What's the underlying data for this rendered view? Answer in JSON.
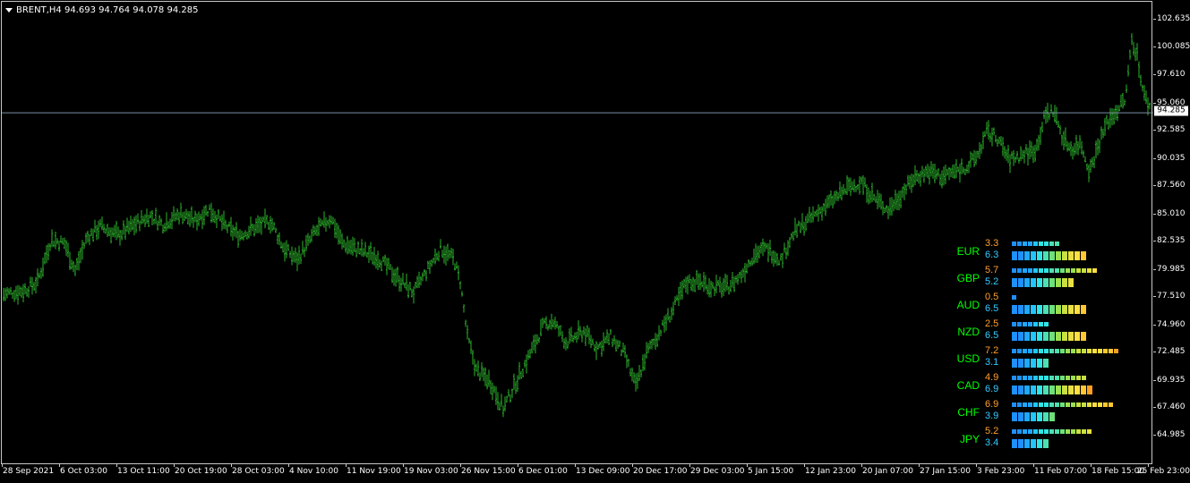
{
  "header": {
    "symbol_info": "BRENT,H4  94.693 94.764 94.078 94.285"
  },
  "price_axis": {
    "labels": [
      "102.635",
      "100.085",
      "97.610",
      "95.060",
      "92.585",
      "90.035",
      "87.560",
      "85.010",
      "82.535",
      "79.985",
      "77.510",
      "74.960",
      "72.485",
      "69.935",
      "67.460",
      "64.985"
    ],
    "label_values": [
      102.635,
      100.085,
      97.61,
      95.06,
      92.585,
      90.035,
      87.56,
      85.01,
      82.535,
      79.985,
      77.51,
      74.96,
      72.485,
      69.935,
      67.46,
      64.985
    ],
    "current_price": "94.285",
    "current_price_value": 94.285
  },
  "time_axis": {
    "labels": [
      "28 Sep 2021",
      "6 Oct 03:00",
      "13 Oct 11:00",
      "20 Oct 19:00",
      "28 Oct 03:00",
      "4 Nov 10:00",
      "11 Nov 19:00",
      "19 Nov 03:00",
      "26 Nov 15:00",
      "6 Dec 01:00",
      "13 Dec 09:00",
      "20 Dec 17:00",
      "29 Dec 03:00",
      "5 Jan 15:00",
      "12 Jan 23:00",
      "20 Jan 07:00",
      "27 Jan 15:00",
      "3 Feb 23:00",
      "11 Feb 07:00",
      "18 Feb 15:00",
      "25 Feb 23:00"
    ]
  },
  "chart_data": {
    "type": "line",
    "title": "",
    "xlabel": "",
    "ylabel": "",
    "ylim": [
      64.0,
      104.0
    ],
    "candle_color": "#2bb52b",
    "price_line_color": "#7a8fa6",
    "anchors": [
      [
        0,
        77.8
      ],
      [
        10,
        78.0
      ],
      [
        25,
        78.2
      ],
      [
        40,
        79.0
      ],
      [
        55,
        82.8
      ],
      [
        70,
        82.5
      ],
      [
        82,
        80.0
      ],
      [
        95,
        83.0
      ],
      [
        110,
        84.0
      ],
      [
        130,
        83.2
      ],
      [
        145,
        84.0
      ],
      [
        165,
        85.0
      ],
      [
        180,
        84.2
      ],
      [
        200,
        85.2
      ],
      [
        215,
        84.5
      ],
      [
        232,
        85.6
      ],
      [
        250,
        84.0
      ],
      [
        265,
        83.2
      ],
      [
        280,
        83.8
      ],
      [
        300,
        84.5
      ],
      [
        315,
        82.0
      ],
      [
        330,
        81.0
      ],
      [
        350,
        83.5
      ],
      [
        368,
        84.8
      ],
      [
        380,
        82.5
      ],
      [
        400,
        81.8
      ],
      [
        420,
        81.2
      ],
      [
        440,
        79.5
      ],
      [
        460,
        78.0
      ],
      [
        475,
        80.0
      ],
      [
        490,
        82.0
      ],
      [
        505,
        81.0
      ],
      [
        512,
        79.0
      ],
      [
        520,
        74.0
      ],
      [
        530,
        71.0
      ],
      [
        545,
        70.0
      ],
      [
        560,
        67.5
      ],
      [
        575,
        70.0
      ],
      [
        590,
        72.5
      ],
      [
        605,
        75.0
      ],
      [
        615,
        75.5
      ],
      [
        630,
        73.5
      ],
      [
        650,
        74.5
      ],
      [
        665,
        73.0
      ],
      [
        680,
        74.0
      ],
      [
        695,
        72.5
      ],
      [
        708,
        69.5
      ],
      [
        720,
        72.5
      ],
      [
        735,
        74.5
      ],
      [
        750,
        76.5
      ],
      [
        765,
        79.0
      ],
      [
        780,
        79.0
      ],
      [
        795,
        78.5
      ],
      [
        810,
        78.5
      ],
      [
        825,
        79.5
      ],
      [
        840,
        81.5
      ],
      [
        855,
        82.0
      ],
      [
        870,
        81.0
      ],
      [
        885,
        83.5
      ],
      [
        900,
        84.5
      ],
      [
        915,
        85.5
      ],
      [
        930,
        86.5
      ],
      [
        945,
        87.5
      ],
      [
        960,
        88.0
      ],
      [
        975,
        86.5
      ],
      [
        990,
        85.5
      ],
      [
        1005,
        87.0
      ],
      [
        1020,
        88.5
      ],
      [
        1035,
        89.0
      ],
      [
        1050,
        88.5
      ],
      [
        1065,
        89.0
      ],
      [
        1080,
        89.5
      ],
      [
        1090,
        90.5
      ],
      [
        1100,
        92.5
      ],
      [
        1112,
        92.0
      ],
      [
        1125,
        90.0
      ],
      [
        1140,
        90.5
      ],
      [
        1155,
        91.0
      ],
      [
        1165,
        94.0
      ],
      [
        1175,
        94.5
      ],
      [
        1185,
        92.0
      ],
      [
        1195,
        91.0
      ],
      [
        1205,
        91.5
      ],
      [
        1215,
        89.0
      ],
      [
        1225,
        91.5
      ],
      [
        1235,
        93.5
      ],
      [
        1245,
        94.5
      ],
      [
        1255,
        95.5
      ],
      [
        1262,
        101.0
      ],
      [
        1268,
        99.5
      ],
      [
        1275,
        96.0
      ],
      [
        1285,
        94.3
      ]
    ],
    "current_price": 94.285
  },
  "currency_strength": {
    "title": "",
    "rows": [
      {
        "name": "EUR",
        "v1": "3.3",
        "v2": "6.3",
        "n1": 3.3,
        "n2": 6.3
      },
      {
        "name": "GBP",
        "v1": "5.7",
        "v2": "5.2",
        "n1": 5.7,
        "n2": 5.2
      },
      {
        "name": "AUD",
        "v1": "0.5",
        "v2": "6.5",
        "n1": 0.5,
        "n2": 6.5
      },
      {
        "name": "NZD",
        "v1": "2.5",
        "v2": "6.5",
        "n1": 2.5,
        "n2": 6.5
      },
      {
        "name": "USD",
        "v1": "7.2",
        "v2": "3.1",
        "n1": 7.2,
        "n2": 3.1
      },
      {
        "name": "CAD",
        "v1": "4.9",
        "v2": "6.9",
        "n1": 4.9,
        "n2": 6.9
      },
      {
        "name": "CHF",
        "v1": "6.9",
        "v2": "3.9",
        "n1": 6.9,
        "n2": 3.9
      },
      {
        "name": "JPY",
        "v1": "5.2",
        "v2": "3.4",
        "n1": 5.2,
        "n2": 3.4
      }
    ],
    "colors": [
      "#1e90ff",
      "#1fa8ff",
      "#22c6ff",
      "#2ee6e6",
      "#4de0b0",
      "#6fe07a",
      "#9be050",
      "#c8e040",
      "#e8e040",
      "#ffe040",
      "#ffc830",
      "#ffa020"
    ]
  }
}
